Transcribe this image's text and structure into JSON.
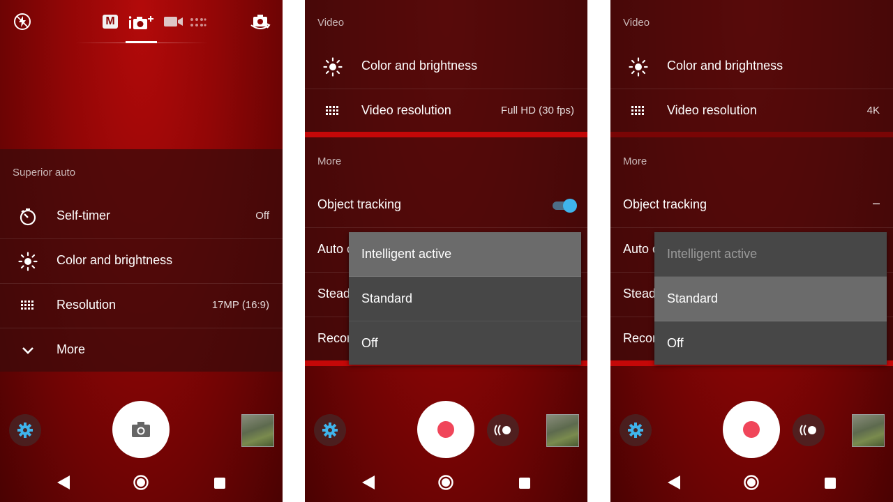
{
  "panel1": {
    "section_title": "Superior auto",
    "rows": [
      {
        "icon": "self-timer-icon",
        "label": "Self-timer",
        "value": "Off"
      },
      {
        "icon": "brightness-icon",
        "label": "Color and brightness",
        "value": ""
      },
      {
        "icon": "resolution-grid-icon",
        "label": "Resolution",
        "value": "17MP (16:9)"
      },
      {
        "icon": "chevron-down-icon",
        "label": "More",
        "value": ""
      }
    ],
    "top_modes": [
      "M"
    ]
  },
  "panel2": {
    "section_video": "Video",
    "video_rows": [
      {
        "icon": "brightness-icon",
        "label": "Color and brightness",
        "value": ""
      },
      {
        "icon": "resolution-grid-icon",
        "label": "Video resolution",
        "value": "Full HD (30 fps)"
      }
    ],
    "section_more": "More",
    "more_rows": [
      {
        "label": "Object tracking"
      },
      {
        "label": "Auto c"
      },
      {
        "label": "Stead"
      },
      {
        "label": "Recor"
      }
    ],
    "object_tracking_on": true,
    "popup_options": [
      "Intelligent active",
      "Standard",
      "Off"
    ],
    "popup_selected": "Intelligent active"
  },
  "panel3": {
    "section_video": "Video",
    "video_rows": [
      {
        "icon": "brightness-icon",
        "label": "Color and brightness",
        "value": ""
      },
      {
        "icon": "resolution-grid-icon",
        "label": "Video resolution",
        "value": "4K"
      }
    ],
    "section_more": "More",
    "more_rows": [
      {
        "label": "Object tracking",
        "value": "–"
      },
      {
        "label": "Auto c"
      },
      {
        "label": "Stead"
      },
      {
        "label": "Recor"
      }
    ],
    "popup_options": [
      "Intelligent active",
      "Standard",
      "Off"
    ],
    "popup_selected": "Standard",
    "popup_disabled": "Intelligent active"
  },
  "colors": {
    "accent_blue": "#3fb4ec",
    "record_red": "#f0465a",
    "panel_red": "#920606"
  }
}
